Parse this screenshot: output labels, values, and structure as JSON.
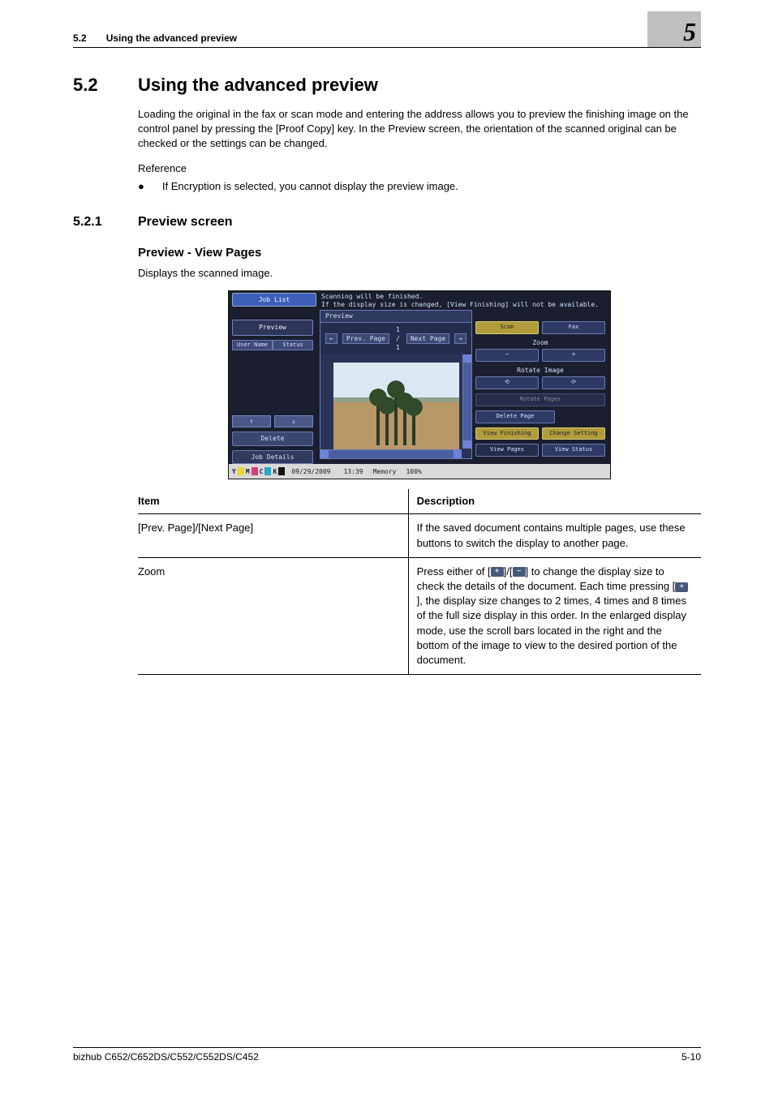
{
  "running_head": {
    "num": "5.2",
    "title": "Using the advanced preview"
  },
  "chapter_number": "5",
  "section": {
    "num": "5.2",
    "title": "Using the advanced preview"
  },
  "intro_paragraph": "Loading the original in the fax or scan mode and entering the address allows you to preview the finishing image on the control panel by pressing the [Proof Copy] key. In the Preview screen, the orientation of the scanned original can be checked or the settings can be changed.",
  "reference_label": "Reference",
  "reference_bullet": "If Encryption is selected, you cannot display the preview image.",
  "subsection": {
    "num": "5.2.1",
    "title": "Preview screen"
  },
  "subhead": "Preview - View Pages",
  "subhead_caption": "Displays the scanned image.",
  "lcd": {
    "job_list": "Job List",
    "head1": "Scanning will be finished.",
    "head2": "If the display size is changed, [View Finishing] will not be available.",
    "preview_btn": "Preview",
    "user_name_tab": "User Name",
    "status_tab": "Status",
    "delete": "Delete",
    "job_details": "Job Details",
    "preview_tab": "Preview",
    "prev_page": "Prev. Page",
    "page_count": "1 /    1",
    "next_page": "Next Page",
    "scan": "Scan",
    "fax": "Fax",
    "zoom": "Zoom",
    "rotate_image": "Rotate Image",
    "rotate_pages": "Rotate Pages",
    "delete_page": "Delete Page",
    "view_finishing": "View Finishing",
    "change_setting": "Change Setting",
    "view_pages": "View Pages",
    "view_status": "View Status",
    "date": "09/29/2009",
    "time": "13:39",
    "memory_label": "Memory",
    "memory_val": "100%",
    "toner_y": "Y",
    "toner_m": "M",
    "toner_c": "C",
    "toner_k": "K"
  },
  "table": {
    "h_item": "Item",
    "h_desc": "Description",
    "r1_item": "[Prev. Page]/[Next Page]",
    "r1_desc": "If the saved document contains multiple pages, use these buttons to switch the display to another page.",
    "r2_item": "Zoom",
    "r2_d1": "Press either of [",
    "r2_d2": "]/[",
    "r2_d3": "] to change the display size to check the details of the document. Each time pressing [",
    "r2_d4": "], the display size changes to 2 times, 4 times and 8 times of the full size display in this order. In the enlarged display mode, use the scroll bars located in the right and the bottom of the image to view to the desired portion of the document."
  },
  "footer": {
    "left": "bizhub C652/C652DS/C552/C552DS/C452",
    "right": "5-10"
  }
}
